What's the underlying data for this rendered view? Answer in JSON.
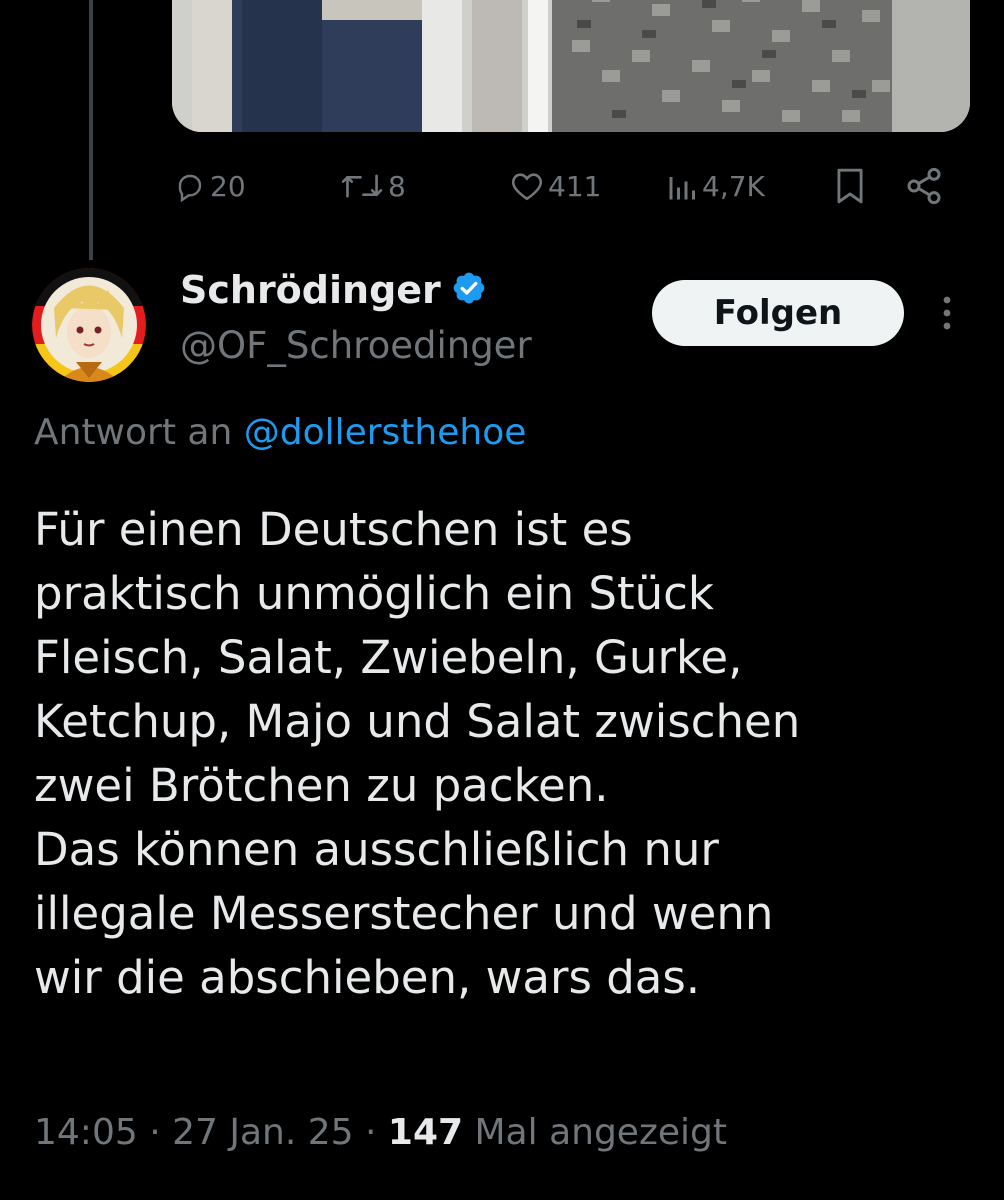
{
  "tweet_above": {
    "actions": {
      "replies": "20",
      "retweets": "8",
      "likes": "411",
      "views": "4,7K"
    }
  },
  "tweet": {
    "display_name": "Schrödinger",
    "handle": "@OF_Schroedinger",
    "follow_label": "Folgen",
    "reply_prefix": "Antwort an",
    "reply_mention": "@dollersthehoe",
    "text_lines": [
      "Für einen Deutschen ist es",
      "praktisch unmöglich ein Stück",
      "Fleisch, Salat, Zwiebeln, Gurke,",
      "Ketchup, Majo und Salat zwischen",
      "zwei Brötchen zu packen.",
      "Das können ausschließlich nur",
      "illegale Messerstecher und wenn",
      "wir die abschieben, wars das."
    ],
    "time": "14:05",
    "date": "27 Jan. 25",
    "view_count": "147",
    "view_label": "Mal angezeigt"
  },
  "colors": {
    "background": "#000000",
    "text": "#e7e9ea",
    "secondary": "#71767b",
    "accent": "#1d9bf0",
    "verified": "#1d9bf0"
  },
  "icons": {
    "reply": "reply-icon",
    "retweet": "retweet-icon",
    "like": "heart-icon",
    "views": "views-icon",
    "bookmark": "bookmark-icon",
    "share": "share-icon",
    "verified": "verified-badge-icon",
    "more": "more-dots-icon"
  }
}
